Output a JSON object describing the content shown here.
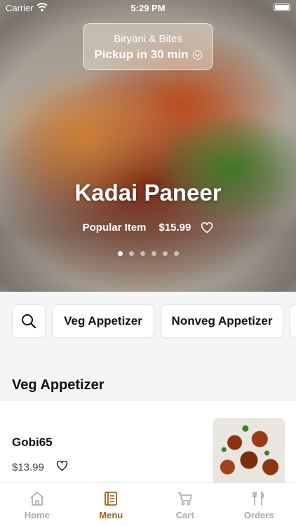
{
  "status_bar": {
    "carrier": "Carrier",
    "time": "5:29 PM"
  },
  "store": {
    "name": "Biryani & Bites",
    "pickup": "Pickup in 30 min"
  },
  "hero": {
    "title": "Kadai Paneer",
    "tag": "Popular Item",
    "price": "$15.99",
    "slide_count": 6,
    "active_slide": 0
  },
  "categories": {
    "items": [
      "Veg Appetizer",
      "Nonveg Appetizer"
    ]
  },
  "section": {
    "title": "Veg Appetizer"
  },
  "menu_items": [
    {
      "name": "Gobi65",
      "price": "$13.99"
    }
  ],
  "tabs": [
    {
      "label": "Home",
      "icon": "home-icon",
      "active": false
    },
    {
      "label": "Menu",
      "icon": "menu-book-icon",
      "active": true
    },
    {
      "label": "Cart",
      "icon": "cart-icon",
      "active": false
    },
    {
      "label": "Orders",
      "icon": "fork-knife-icon",
      "active": false
    }
  ],
  "colors": {
    "accent": "#a0621c",
    "inactive_tab": "#aaaaaa",
    "background": "#f5f5f5"
  }
}
